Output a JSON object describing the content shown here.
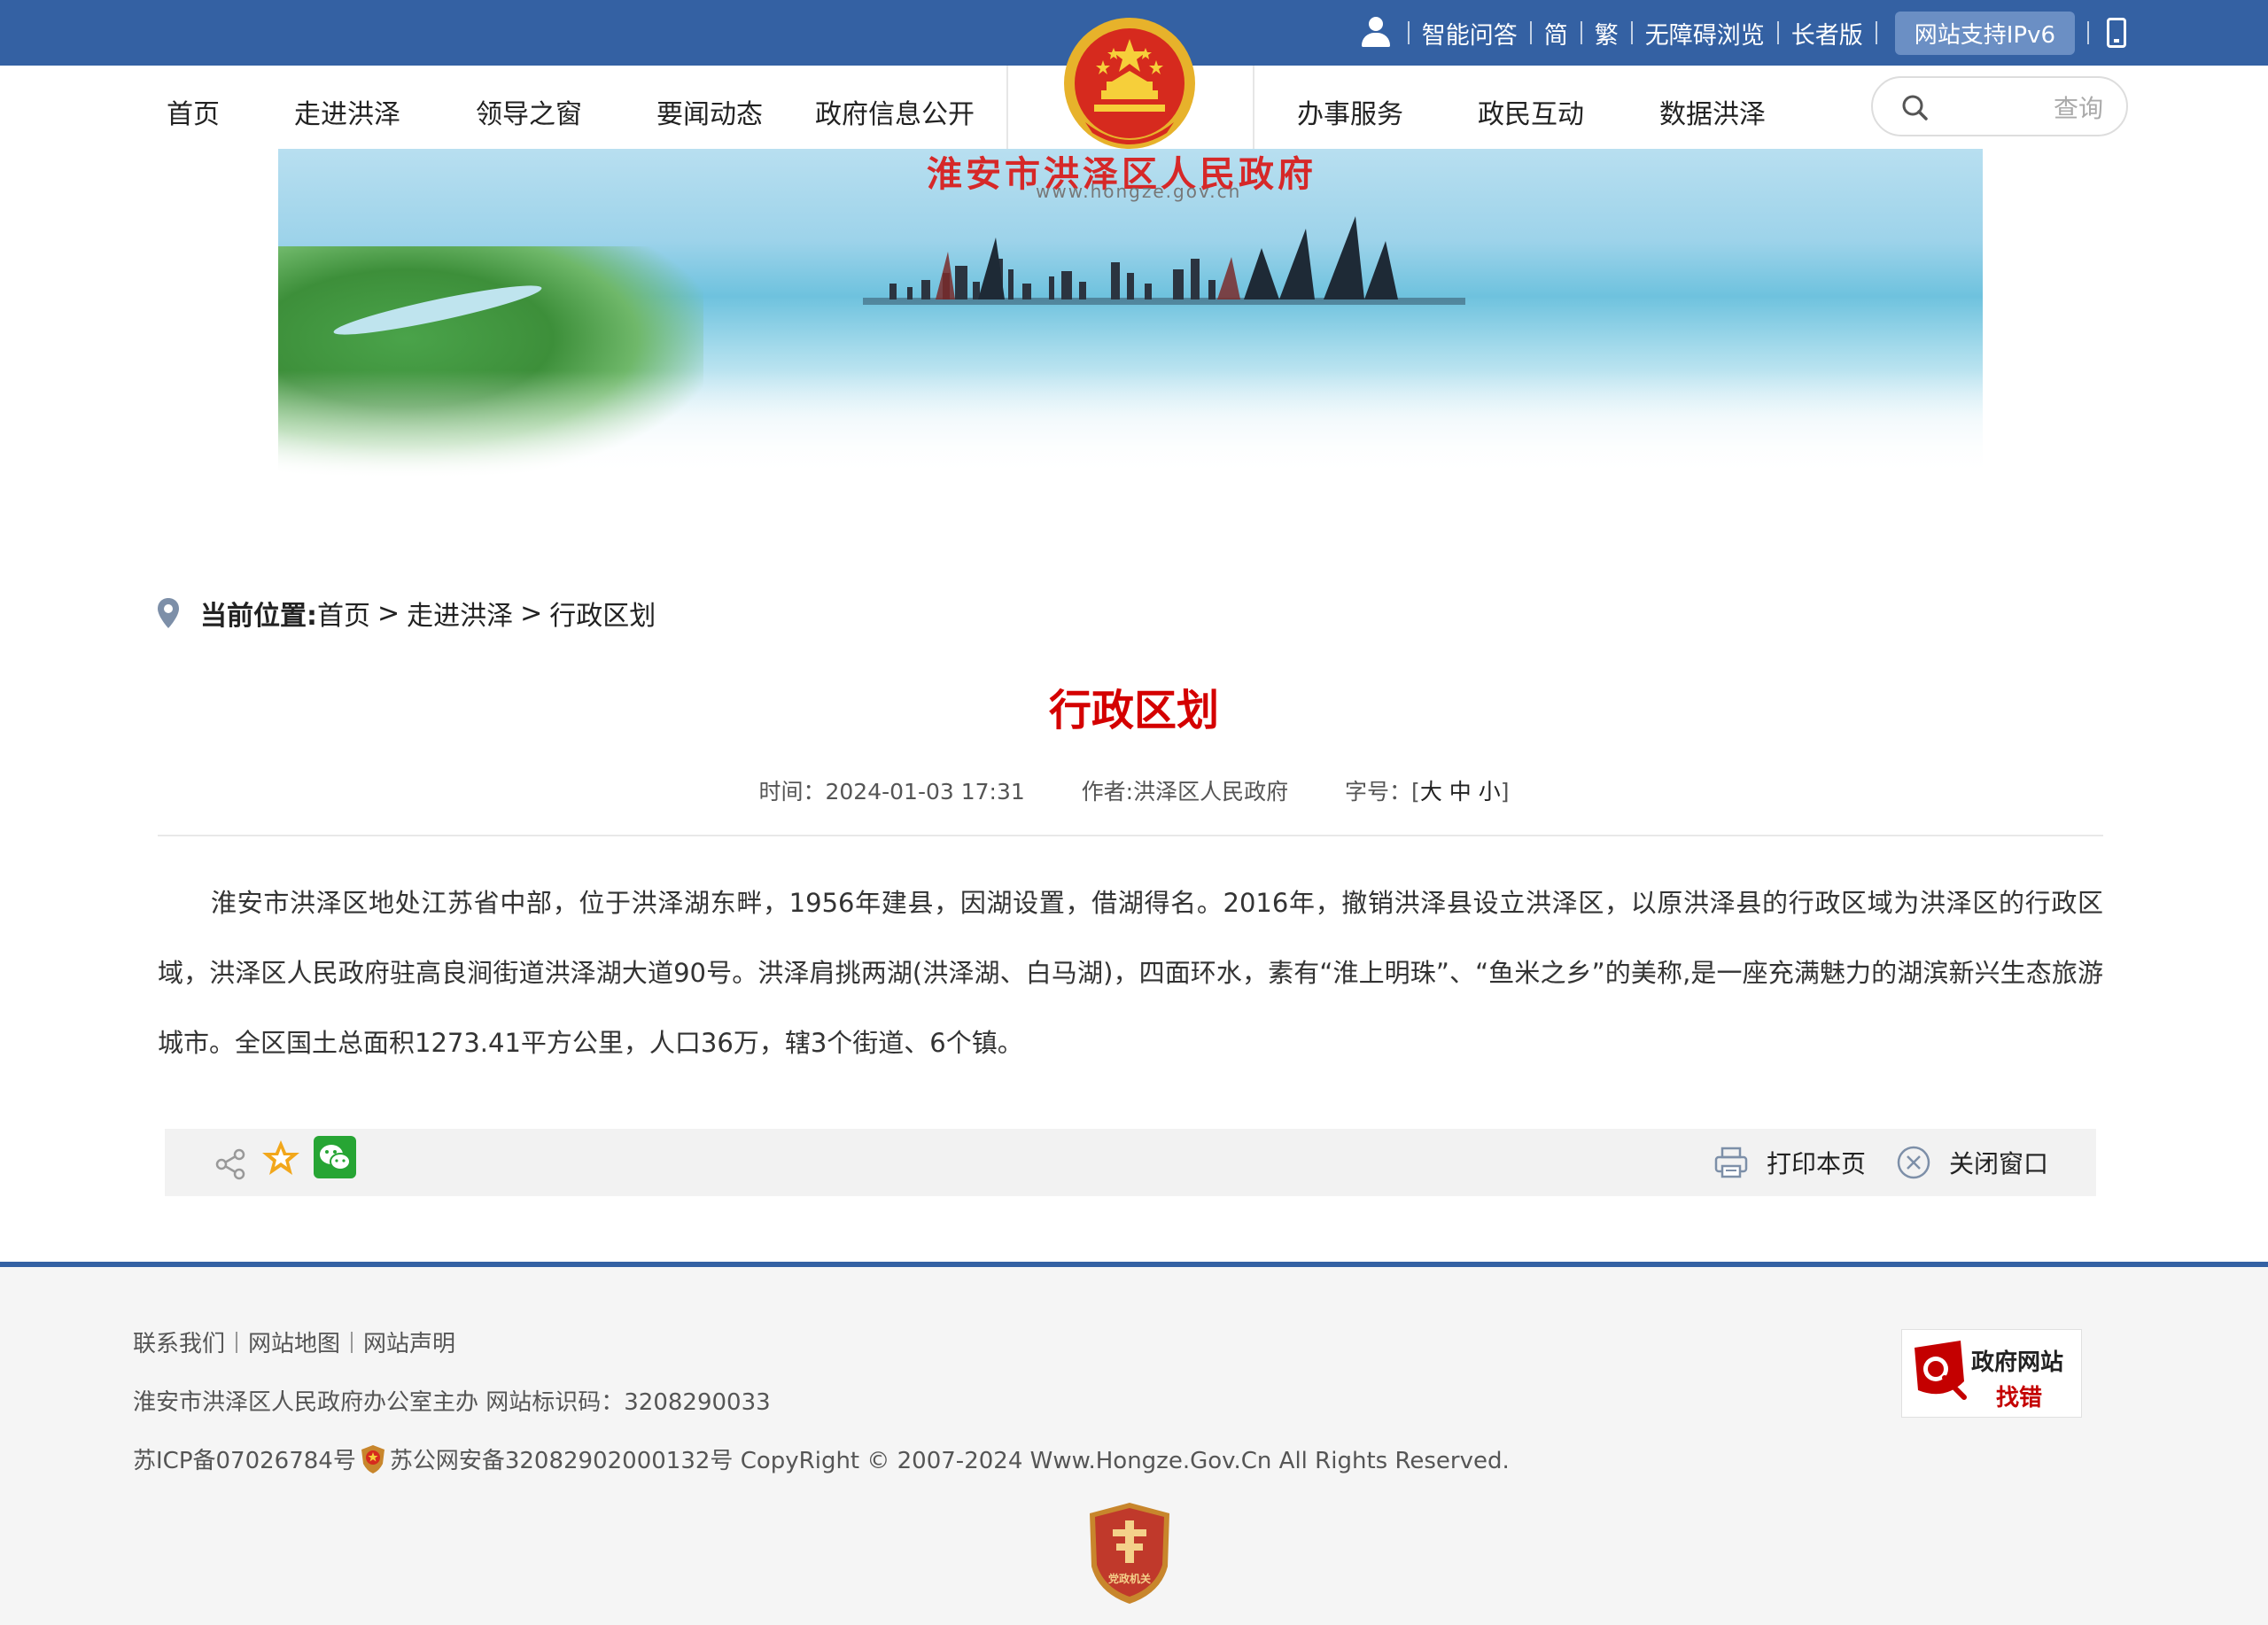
{
  "top_links": {
    "smart_qa": "智能问答",
    "simplified": "简",
    "traditional": "繁",
    "accessibility": "无障碍浏览",
    "elderly": "长者版",
    "ipv6": "网站支持IPv6"
  },
  "nav": {
    "items": [
      "首页",
      "走进洪泽",
      "领导之窗",
      "要闻动态",
      "政府信息公开",
      "办事服务",
      "政民互动",
      "数据洪泽"
    ]
  },
  "search": {
    "placeholder": "查询"
  },
  "banner": {
    "title": "淮安市洪泽区人民政府",
    "url": "www.hongze.gov.cn"
  },
  "breadcrumb": {
    "label": "当前位置:",
    "home": "首页",
    "section": "走进洪泽",
    "current": "行政区划",
    "separator": ">"
  },
  "article": {
    "title": "行政区划",
    "time_label": "时间：",
    "time": "2024-01-03 17:31",
    "author_label": "作者:",
    "author": "洪泽区人民政府",
    "fontsize_label": "字号：",
    "fontsize_open": "[",
    "font_large": "大",
    "font_medium": "中",
    "font_small": "小",
    "fontsize_close": "]",
    "content": "淮安市洪泽区地处江苏省中部，位于洪泽湖东畔，1956年建县，因湖设置，借湖得名。2016年，撤销洪泽县设立洪泽区，以原洪泽县的行政区域为洪泽区的行政区域，洪泽区人民政府驻高良涧街道洪泽湖大道90号。洪泽肩挑两湖(洪泽湖、白马湖)，四面环水，素有“淮上明珠”、“鱼米之乡”的美称,是一座充满魅力的湖滨新兴生态旅游城市。全区国土总面积1273.41平方公里，人口36万，辖3个街道、6个镇。"
  },
  "actions": {
    "print": "打印本页",
    "close": "关闭窗口"
  },
  "footer": {
    "links": [
      "联系我们",
      "网站地图",
      "网站声明"
    ],
    "host": "淮安市洪泽区人民政府办公室主办 网站标识码：3208290033",
    "icp": "苏ICP备07026784号",
    "police": "苏公网安备32082902000132号 CopyRight © 2007-2024 Www.Hongze.Gov.Cn All Rights Reserved.",
    "findbug_1": "政府网站",
    "findbug_2": "找错",
    "party_badge_text": "党政机关"
  },
  "colors": {
    "brand_blue": "#3461a3",
    "title_red": "#d40000",
    "footer_bg": "#f5f5f5"
  }
}
